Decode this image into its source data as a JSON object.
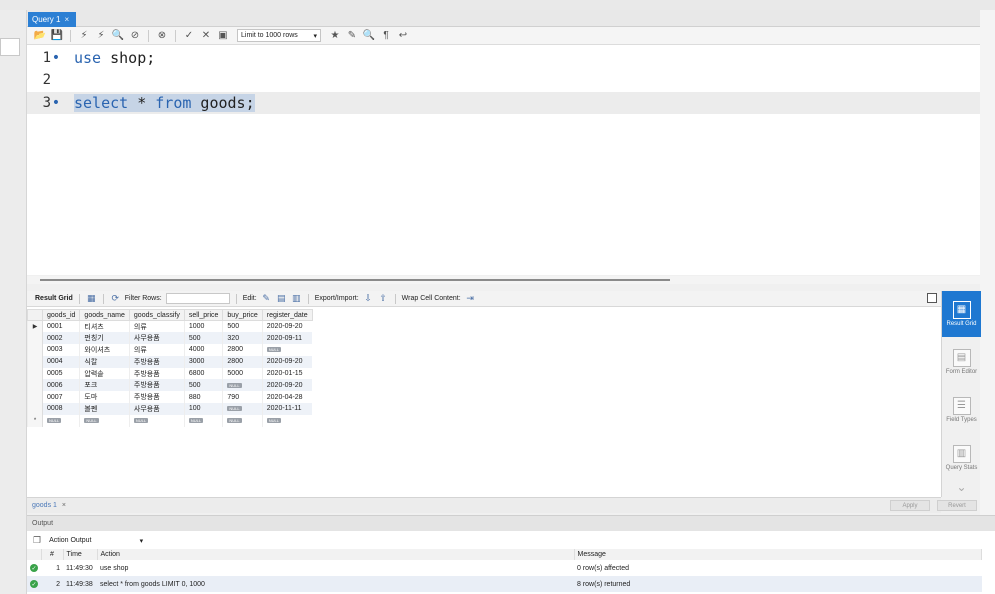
{
  "query_tab": {
    "label": "Query 1",
    "close": "×"
  },
  "toolbar": {
    "limit_label": "Limit to 1000 rows"
  },
  "editor": {
    "lines": [
      {
        "num": "1",
        "code": "use shop;"
      },
      {
        "num": "2",
        "code": ""
      },
      {
        "num": "3",
        "code": "select * from goods;"
      }
    ]
  },
  "result_toolbar": {
    "result_grid": "Result Grid",
    "filter_rows": "Filter Rows:",
    "edit": "Edit:",
    "export_import": "Export/Import:",
    "wrap": "Wrap Cell Content:"
  },
  "grid": {
    "columns": [
      "goods_id",
      "goods_name",
      "goods_classify",
      "sell_price",
      "buy_price",
      "register_date"
    ],
    "rows": [
      [
        "0001",
        "티셔츠",
        "의류",
        "1000",
        "500",
        "2020-09-20"
      ],
      [
        "0002",
        "펀칭기",
        "사무용품",
        "500",
        "320",
        "2020-09-11"
      ],
      [
        "0003",
        "와이셔츠",
        "의류",
        "4000",
        "2800",
        "NULL"
      ],
      [
        "0004",
        "식칼",
        "주방용품",
        "3000",
        "2800",
        "2020-09-20"
      ],
      [
        "0005",
        "압력솥",
        "주방용품",
        "6800",
        "5000",
        "2020-01-15"
      ],
      [
        "0006",
        "포크",
        "주방용품",
        "500",
        "NULL",
        "2020-09-20"
      ],
      [
        "0007",
        "도마",
        "주방용품",
        "880",
        "790",
        "2020-04-28"
      ],
      [
        "0008",
        "볼펜",
        "사무용품",
        "100",
        "NULL",
        "2020-11-11"
      ]
    ],
    "null_label": "NULL"
  },
  "side_panel": {
    "result_grid": "Result Grid",
    "form_editor": "Form Editor",
    "field_types": "Field Types",
    "query_stats": "Query Stats"
  },
  "result_tabs": {
    "goods_tab": "goods 1",
    "close": "×",
    "apply": "Apply",
    "revert": "Revert"
  },
  "output": {
    "title": "Output",
    "action_output": "Action Output",
    "columns": {
      "num": "#",
      "time": "Time",
      "action": "Action",
      "message": "Message"
    },
    "rows": [
      {
        "num": "1",
        "time": "11:49:30",
        "action": "use shop",
        "message": "0 row(s) affected"
      },
      {
        "num": "2",
        "time": "11:49:38",
        "action": "select * from goods LIMIT 0, 1000",
        "message": "8 row(s) returned"
      }
    ]
  }
}
